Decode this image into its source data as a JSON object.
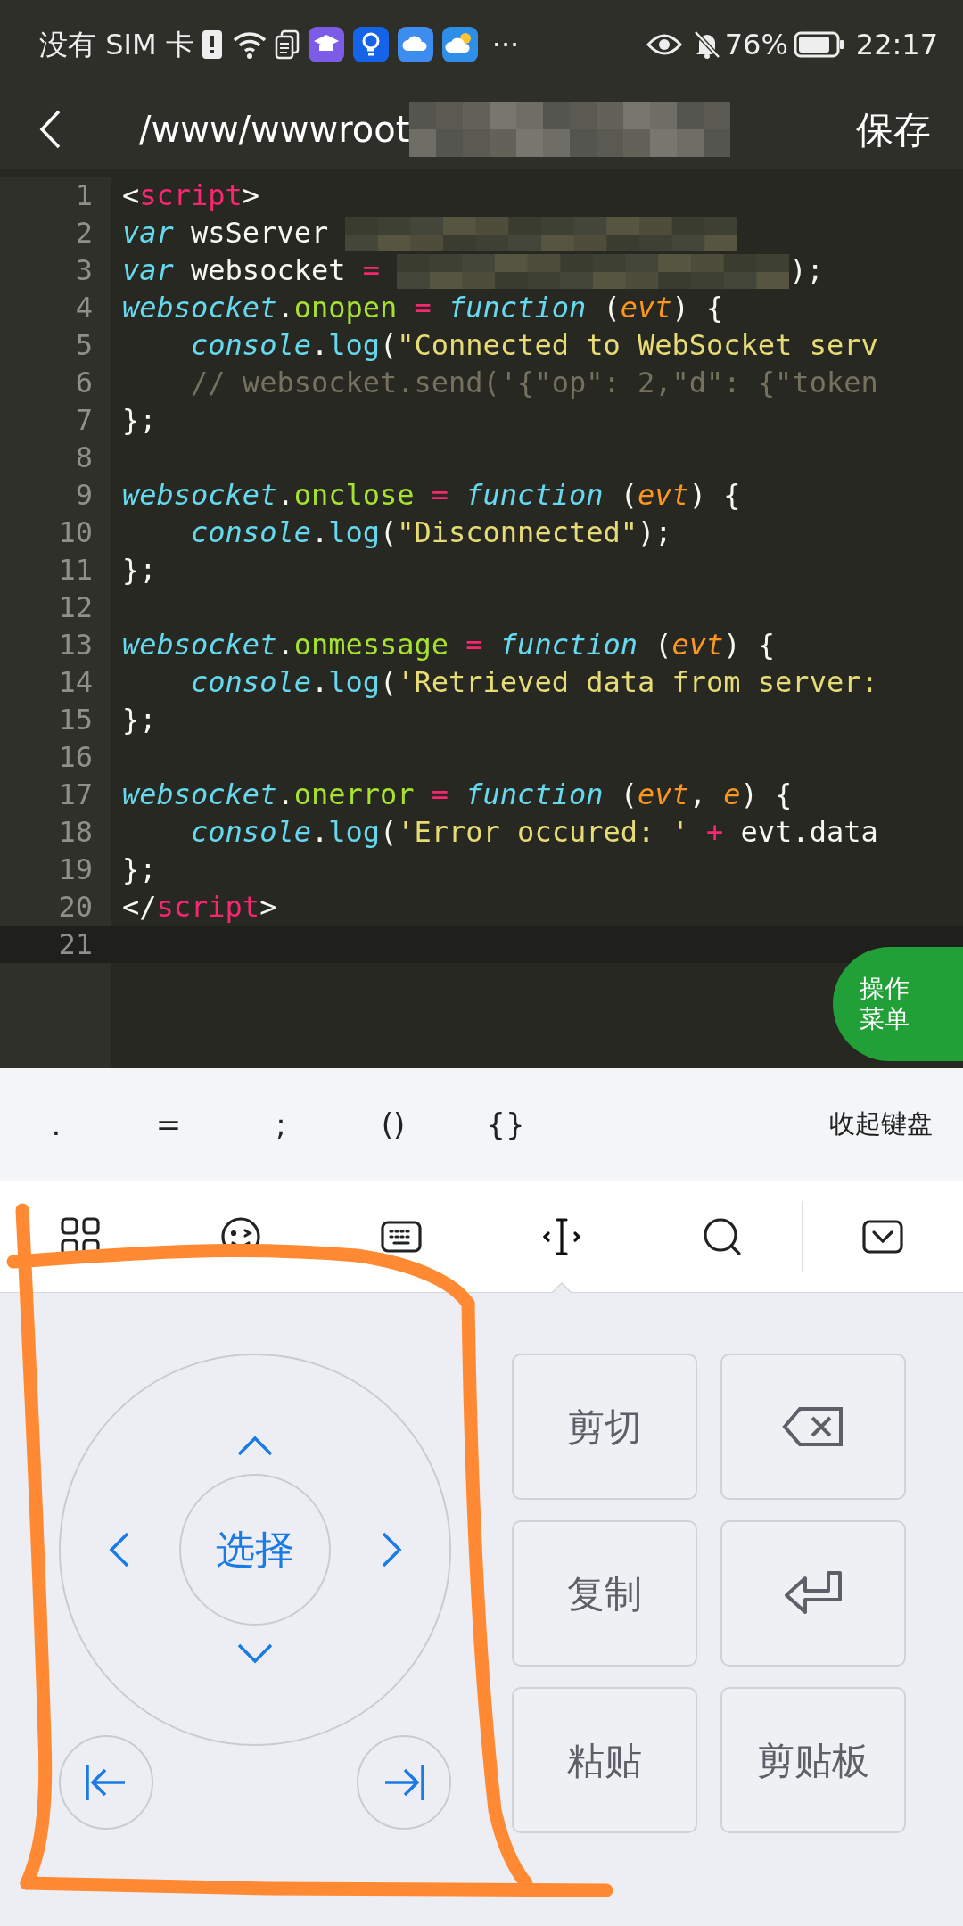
{
  "status_bar": {
    "carrier": "没有 SIM 卡",
    "more": "···",
    "battery": "76%",
    "time": "22:17"
  },
  "header": {
    "title": "/www/wwwroot",
    "redacted": true,
    "save": "保存"
  },
  "editor": {
    "lines": [
      {
        "number": "1",
        "current": false,
        "tokens": [
          {
            "kind": "plain",
            "text": "<"
          },
          {
            "kind": "tag",
            "text": "script"
          },
          {
            "kind": "plain",
            "text": ">"
          }
        ]
      },
      {
        "number": "2",
        "current": false,
        "tokens": [
          {
            "kind": "kw",
            "text": "var"
          },
          {
            "kind": "plain",
            "text": " wsServer "
          },
          {
            "kind": "redacted"
          }
        ]
      },
      {
        "number": "3",
        "current": false,
        "tokens": [
          {
            "kind": "kw",
            "text": "var"
          },
          {
            "kind": "plain",
            "text": " websocket "
          },
          {
            "kind": "op",
            "text": "= "
          },
          {
            "kind": "redacted"
          },
          {
            "kind": "plain",
            "text": ");"
          }
        ]
      },
      {
        "number": "4",
        "current": false,
        "tokens": [
          {
            "kind": "obj",
            "text": "websocket"
          },
          {
            "kind": "plain",
            "text": "."
          },
          {
            "kind": "prop",
            "text": "onopen"
          },
          {
            "kind": "op",
            "text": " = "
          },
          {
            "kind": "kw",
            "text": "function"
          },
          {
            "kind": "plain",
            "text": " ("
          },
          {
            "kind": "param",
            "text": "evt"
          },
          {
            "kind": "plain",
            "text": ") {"
          }
        ]
      },
      {
        "number": "5",
        "current": false,
        "tokens": [
          {
            "kind": "obj",
            "text": "    console"
          },
          {
            "kind": "plain",
            "text": "."
          },
          {
            "kind": "fn",
            "text": "log"
          },
          {
            "kind": "plain",
            "text": "("
          },
          {
            "kind": "str",
            "text": "\"Connected to WebSocket serv"
          }
        ]
      },
      {
        "number": "6",
        "current": false,
        "tokens": [
          {
            "kind": "comment",
            "text": "    // websocket.send('{\"op\": 2,\"d\": {\"token"
          }
        ]
      },
      {
        "number": "7",
        "current": false,
        "tokens": [
          {
            "kind": "plain",
            "text": "};"
          }
        ]
      },
      {
        "number": "8",
        "current": false
      },
      {
        "number": "9",
        "current": false,
        "tokens": [
          {
            "kind": "obj",
            "text": "websocket"
          },
          {
            "kind": "plain",
            "text": "."
          },
          {
            "kind": "prop",
            "text": "onclose"
          },
          {
            "kind": "op",
            "text": " = "
          },
          {
            "kind": "kw",
            "text": "function"
          },
          {
            "kind": "plain",
            "text": " ("
          },
          {
            "kind": "param",
            "text": "evt"
          },
          {
            "kind": "plain",
            "text": ") {"
          }
        ]
      },
      {
        "number": "10",
        "current": false,
        "tokens": [
          {
            "kind": "obj",
            "text": "    console"
          },
          {
            "kind": "plain",
            "text": "."
          },
          {
            "kind": "fn",
            "text": "log"
          },
          {
            "kind": "plain",
            "text": "("
          },
          {
            "kind": "str",
            "text": "\"Disconnected\""
          },
          {
            "kind": "plain",
            "text": ");"
          }
        ]
      },
      {
        "number": "11",
        "current": false,
        "tokens": [
          {
            "kind": "plain",
            "text": "};"
          }
        ]
      },
      {
        "number": "12",
        "current": false
      },
      {
        "number": "13",
        "current": false,
        "tokens": [
          {
            "kind": "obj",
            "text": "websocket"
          },
          {
            "kind": "plain",
            "text": "."
          },
          {
            "kind": "prop",
            "text": "onmessage"
          },
          {
            "kind": "op",
            "text": " = "
          },
          {
            "kind": "kw",
            "text": "function"
          },
          {
            "kind": "plain",
            "text": " ("
          },
          {
            "kind": "param",
            "text": "evt"
          },
          {
            "kind": "plain",
            "text": ") {"
          }
        ]
      },
      {
        "number": "14",
        "current": false,
        "tokens": [
          {
            "kind": "obj",
            "text": "    console"
          },
          {
            "kind": "plain",
            "text": "."
          },
          {
            "kind": "fn",
            "text": "log"
          },
          {
            "kind": "plain",
            "text": "("
          },
          {
            "kind": "str",
            "text": "'Retrieved data from server:"
          }
        ]
      },
      {
        "number": "15",
        "current": false,
        "tokens": [
          {
            "kind": "plain",
            "text": "};"
          }
        ]
      },
      {
        "number": "16",
        "current": false
      },
      {
        "number": "17",
        "current": false,
        "tokens": [
          {
            "kind": "obj",
            "text": "websocket"
          },
          {
            "kind": "plain",
            "text": "."
          },
          {
            "kind": "prop",
            "text": "onerror"
          },
          {
            "kind": "op",
            "text": " = "
          },
          {
            "kind": "kw",
            "text": "function"
          },
          {
            "kind": "plain",
            "text": " ("
          },
          {
            "kind": "param",
            "text": "evt"
          },
          {
            "kind": "plain",
            "text": ", "
          },
          {
            "kind": "param",
            "text": "e"
          },
          {
            "kind": "plain",
            "text": ") {"
          }
        ]
      },
      {
        "number": "18",
        "current": false,
        "tokens": [
          {
            "kind": "obj",
            "text": "    console"
          },
          {
            "kind": "plain",
            "text": "."
          },
          {
            "kind": "fn",
            "text": "log"
          },
          {
            "kind": "plain",
            "text": "("
          },
          {
            "kind": "str",
            "text": "'Error occured: '"
          },
          {
            "kind": "op",
            "text": " + "
          },
          {
            "kind": "plain",
            "text": "evt.data"
          }
        ]
      },
      {
        "number": "19",
        "current": false,
        "tokens": [
          {
            "kind": "plain",
            "text": "};"
          }
        ]
      },
      {
        "number": "20",
        "current": false,
        "tokens": [
          {
            "kind": "plain",
            "text": "</"
          },
          {
            "kind": "tag",
            "text": "script"
          },
          {
            "kind": "plain",
            "text": ">"
          }
        ]
      },
      {
        "number": "21",
        "current": true
      }
    ]
  },
  "fab": {
    "label": "操作菜单"
  },
  "shortcut_bar": {
    "keys": [
      ".",
      "=",
      ";",
      "()",
      "{}"
    ],
    "collapse": "收起键盘"
  },
  "toolbar": [
    {
      "kind": "apps",
      "selected": false
    },
    {
      "kind": "emoji",
      "selected": false
    },
    {
      "kind": "keyboard",
      "selected": false
    },
    {
      "kind": "cursor",
      "selected": true
    },
    {
      "kind": "search",
      "selected": false
    },
    {
      "kind": "hide",
      "selected": false
    }
  ],
  "cursor_pad": {
    "select": "选择"
  },
  "edit_keys": [
    {
      "kind": "text",
      "label": "剪切"
    },
    {
      "kind": "backspace"
    },
    {
      "kind": "text",
      "label": "复制"
    },
    {
      "kind": "enter"
    },
    {
      "kind": "text",
      "label": "粘贴"
    },
    {
      "kind": "text",
      "label": "剪贴板"
    }
  ],
  "annotation": {
    "kind": "freehand"
  }
}
